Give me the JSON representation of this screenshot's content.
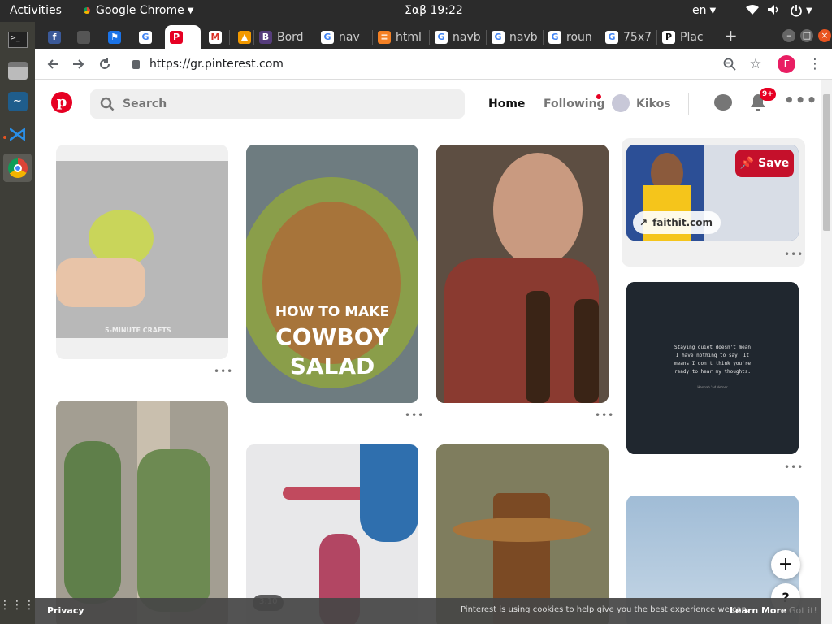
{
  "os": {
    "activities": "Activities",
    "app_menu": "Google Chrome",
    "clock": "Σαβ 19:22",
    "lang": "en"
  },
  "tabs": [
    {
      "label": "",
      "favicon": "facebook-icon",
      "color": "#3b5998",
      "glyph": "f"
    },
    {
      "label": "",
      "favicon": "blank-icon",
      "color": "#555",
      "glyph": ""
    },
    {
      "label": "",
      "favicon": "flag-icon",
      "color": "#1a73e8",
      "glyph": "⚑"
    },
    {
      "label": "",
      "favicon": "google-icon",
      "color": "#fff",
      "glyph": "G"
    },
    {
      "label": "",
      "favicon": "pinterest-icon",
      "color": "#e60023",
      "glyph": "P"
    },
    {
      "label": "",
      "favicon": "gmail-icon",
      "color": "#fff",
      "glyph": "M"
    },
    {
      "label": "",
      "favicon": "warning-icon",
      "color": "#f29900",
      "glyph": "▲"
    },
    {
      "label": "Bord",
      "favicon": "bootstrap-icon",
      "color": "#563d7c",
      "glyph": "B"
    },
    {
      "label": "nav",
      "favicon": "google-icon",
      "color": "#fff",
      "glyph": "G"
    },
    {
      "label": "html",
      "favicon": "stackoverflow-icon",
      "color": "#f48024",
      "glyph": "≡"
    },
    {
      "label": "navb",
      "favicon": "google-icon",
      "color": "#fff",
      "glyph": "G"
    },
    {
      "label": "navb",
      "favicon": "google-icon",
      "color": "#fff",
      "glyph": "G"
    },
    {
      "label": "roun",
      "favicon": "google-icon",
      "color": "#fff",
      "glyph": "G"
    },
    {
      "label": "75x7",
      "favicon": "google-icon",
      "color": "#fff",
      "glyph": "G"
    },
    {
      "label": "Plac",
      "favicon": "placeholder-icon",
      "color": "#fff",
      "glyph": "P"
    }
  ],
  "address": {
    "url": "https://gr.pinterest.com"
  },
  "profile_initial": "Γ",
  "pinterest": {
    "search_placeholder": "Search",
    "nav_home": "Home",
    "nav_following": "Following",
    "nav_user": "Kikos",
    "notif_badge": "9+",
    "save_label": "Save",
    "source_link": "faithit.com",
    "salad_line1": "HOW TO MAKE",
    "salad_line2": "COWBOY",
    "salad_line3": "SALAD",
    "watermark": "5-MINUTE CRAFTS",
    "quote": "Staying quiet doesn't mean I have nothing to say. It means I don't think you're ready to hear my thoughts.",
    "quote_author": "Hannah 'ad Vetner",
    "video_duration": "3:10"
  },
  "cookie": {
    "privacy": "Privacy",
    "message": "Pinterest is using cookies to help give you the best experience we can.",
    "learn_more": "Learn More",
    "got_it": "Got it!"
  }
}
